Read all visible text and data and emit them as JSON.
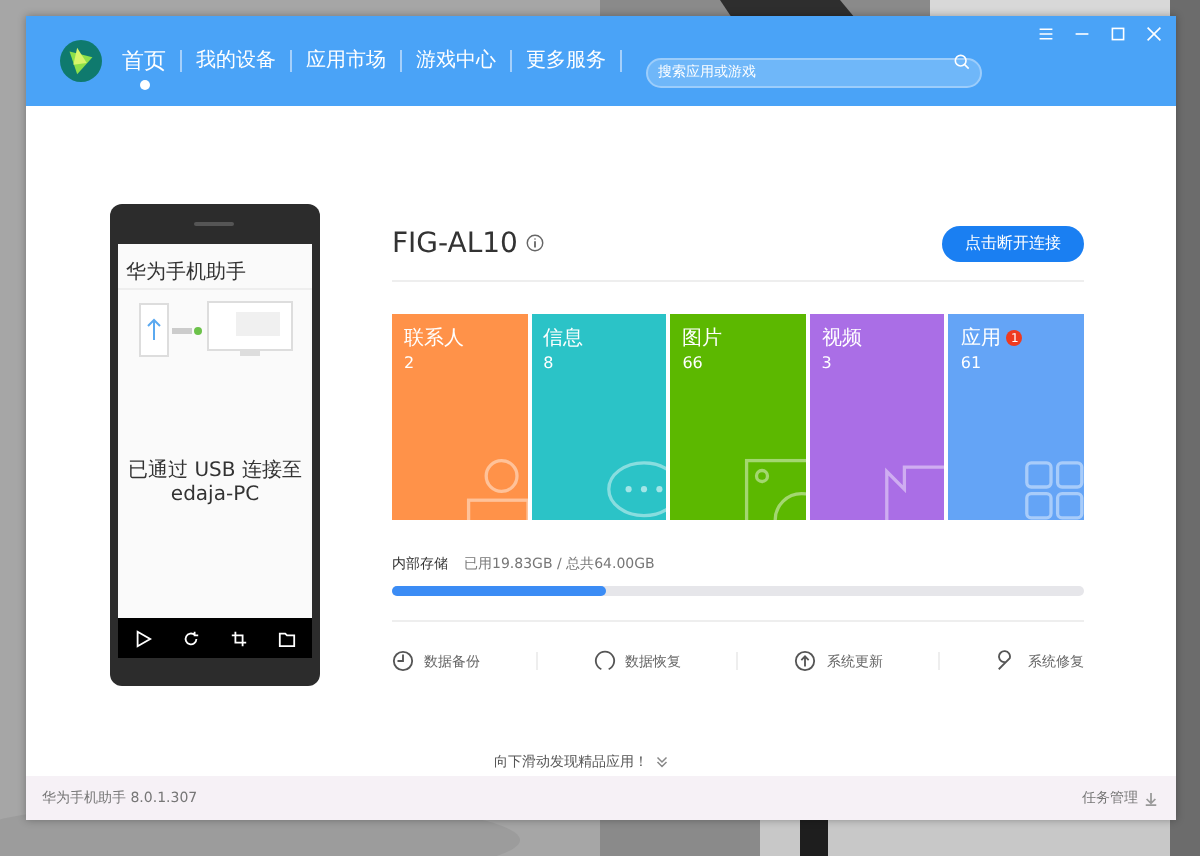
{
  "nav": [
    {
      "label": "首页",
      "selected": true
    },
    {
      "label": "我的设备",
      "selected": false
    },
    {
      "label": "应用市场",
      "selected": false
    },
    {
      "label": "游戏中心",
      "selected": false
    },
    {
      "label": "更多服务",
      "selected": false
    }
  ],
  "search": {
    "placeholder": "搜索应用或游戏"
  },
  "phone": {
    "app_title": "华为手机助手",
    "status": "已通过 USB 连接至edaja-PC"
  },
  "device": {
    "name": "FIG-AL10",
    "disconnect_button": "点击断开连接"
  },
  "tiles": [
    {
      "kind": "contacts",
      "label": "联系人",
      "count": "2",
      "color": "#ff9249"
    },
    {
      "kind": "messages",
      "label": "信息",
      "count": "8",
      "color": "#2bc3c7"
    },
    {
      "kind": "photos",
      "label": "图片",
      "count": "66",
      "color": "#5cb800"
    },
    {
      "kind": "videos",
      "label": "视频",
      "count": "3",
      "color": "#aa6ee6"
    },
    {
      "kind": "apps",
      "label": "应用",
      "count": "61",
      "color": "#64a4f6",
      "badge": "1"
    }
  ],
  "storage": {
    "label": "内部存储",
    "reading": "已用19.83GB / 总共64.00GB",
    "level": 0.31
  },
  "actions": [
    {
      "kind": "backup",
      "label": "数据备份"
    },
    {
      "kind": "restore",
      "label": "数据恢复"
    },
    {
      "kind": "update",
      "label": "系统更新"
    },
    {
      "kind": "repair",
      "label": "系统修复"
    }
  ],
  "hint": "向下滑动发现精品应用！",
  "status_bar": {
    "version": "华为手机助手 8.0.1.307",
    "tasks": "任务管理"
  }
}
